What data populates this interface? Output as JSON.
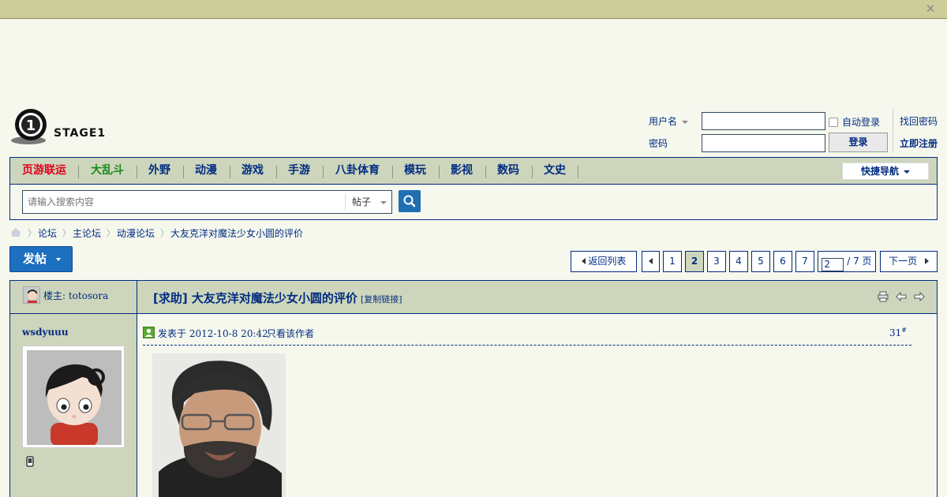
{
  "site": {
    "logo_text": "STAGE1",
    "colors": {
      "nav_bg": "#cdd6bc",
      "primary": "#022c80",
      "accent_red": "#e0001b",
      "accent_green": "#1a8a1a",
      "button_blue": "#1d6fc0"
    }
  },
  "login": {
    "username_label": "用户名",
    "password_label": "密码",
    "auto_login": "自动登录",
    "login_button": "登录",
    "forgot_password": "找回密码",
    "register": "立即注册"
  },
  "nav": {
    "items": [
      "页游联运",
      "大乱斗",
      "外野",
      "动漫",
      "游戏",
      "手游",
      "八卦体育",
      "模玩",
      "影视",
      "数码",
      "文史"
    ],
    "quick_nav": "快捷导航"
  },
  "search": {
    "placeholder": "请输入搜索内容",
    "type": "帖子"
  },
  "breadcrumb": [
    "论坛",
    "主论坛",
    "动漫论坛",
    "大友克洋对魔法少女小圆的评价"
  ],
  "post_button": "发帖",
  "pagination": {
    "back_to_list": "返回列表",
    "pages": [
      "1",
      "2",
      "3",
      "4",
      "5",
      "6",
      "7"
    ],
    "current": "2",
    "input_value": "2",
    "total_text": "/ 7 页",
    "next": "下一页"
  },
  "thread": {
    "owner_label": "楼主: totosora",
    "title": "[求助] 大友克洋对魔法少女小圆的评价",
    "copy_link": "[复制链接]"
  },
  "post": {
    "author": "wsdyuuu",
    "posted_at": "发表于 2012-10-8 20:42",
    "only_author": "只看该作者",
    "floor": "31",
    "floor_mark": "#"
  }
}
